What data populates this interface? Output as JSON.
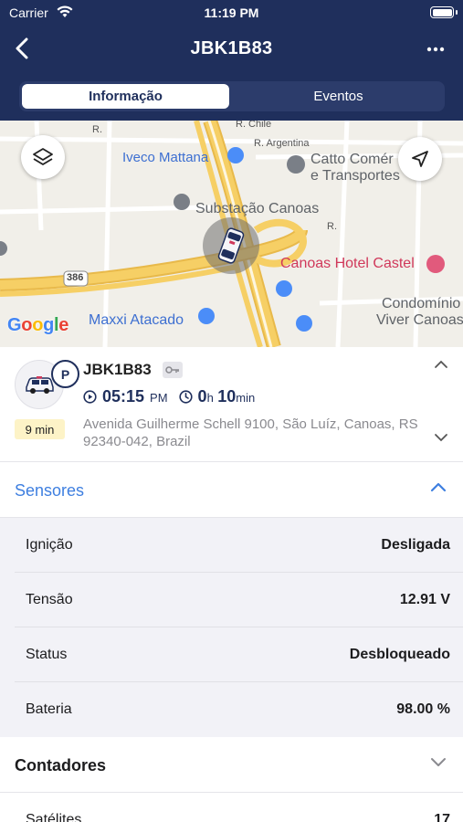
{
  "status_bar": {
    "carrier": "Carrier",
    "time": "11:19 PM"
  },
  "nav": {
    "title": "JBK1B83"
  },
  "tabs": [
    {
      "label": "Informação",
      "active": true
    },
    {
      "label": "Eventos",
      "active": false
    }
  ],
  "map": {
    "labels": {
      "r_chile": "R. Chile",
      "r_argentina": "R. Argentina",
      "r_side_1": "R.",
      "r_side_2": "R.",
      "iveco": "Iveco Mattana",
      "catto_1": "Catto Comér",
      "catto_2": "e Transportes",
      "substacao": "Substação Canoas",
      "hotel": "Canoas Hotel Castel",
      "maxxi": "Maxxi Atacado",
      "condominio_1": "Condomínio",
      "condominio_2": "Viver Canoas",
      "road_386": "386"
    },
    "attribution": {
      "letters": [
        "G",
        "o",
        "o",
        "g",
        "l",
        "e"
      ]
    }
  },
  "vehicle": {
    "plate": "JBK1B83",
    "parking_badge": "P",
    "stopped_duration": "9 min",
    "time_value": "05:15",
    "time_period": "PM",
    "elapsed_hours": "0",
    "elapsed_hours_unit": "h",
    "elapsed_minutes": "10",
    "elapsed_minutes_unit": "min",
    "address": "Avenida Guilherme Schell 9100, São Luíz, Canoas, RS 92340-042, Brazil"
  },
  "sensors": {
    "title": "Sensores",
    "rows": [
      {
        "label": "Ignição",
        "value": "Desligada"
      },
      {
        "label": "Tensão",
        "value": "12.91 V"
      },
      {
        "label": "Status",
        "value": "Desbloqueado"
      },
      {
        "label": "Bateria",
        "value": "98.00 %"
      }
    ]
  },
  "counters": {
    "title": "Contadores",
    "rows": [
      {
        "label": "Satélites",
        "value": "17"
      }
    ]
  },
  "colors": {
    "header_bg": "#1f2f5c",
    "accent_blue": "#3e7fe0",
    "badge_yellow": "#fdf3c7",
    "map_road": "#f6cf65"
  },
  "icons": [
    "back-chevron-icon",
    "more-icon",
    "layers-icon",
    "locate-arrow-icon",
    "key-icon",
    "clock-play-icon",
    "clock-icon",
    "chevron-up-icon",
    "chevron-down-icon",
    "van-icon",
    "wifi-icon",
    "battery-icon"
  ]
}
